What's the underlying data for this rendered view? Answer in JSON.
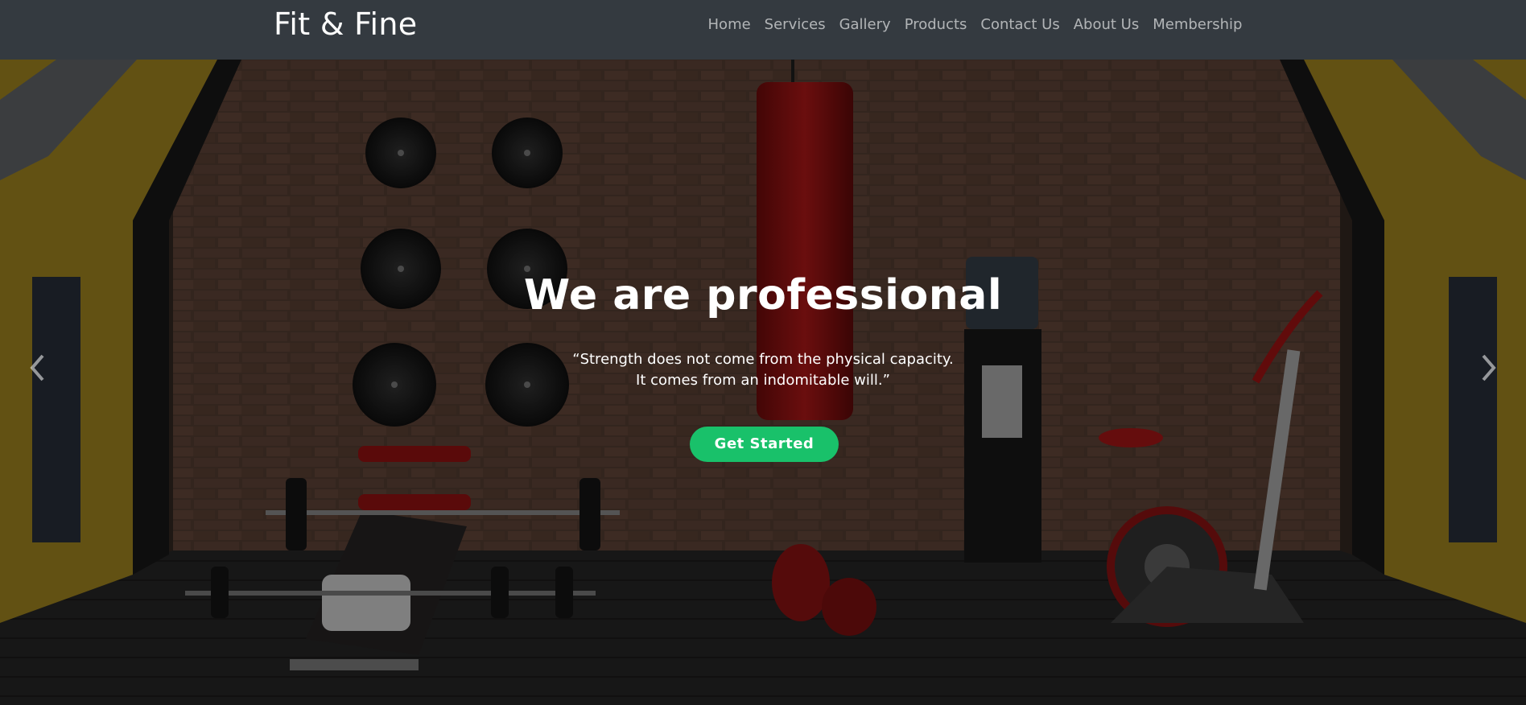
{
  "navbar": {
    "brand": "Fit & Fine",
    "links": [
      "Home",
      "Services",
      "Gallery",
      "Products",
      "Contact Us",
      "About Us",
      "Membership"
    ]
  },
  "hero": {
    "title": "We are professional",
    "quote_line1": "“Strength does not come from the physical capacity.",
    "quote_line2": "It comes from an indomitable will.”",
    "cta_label": "Get Started",
    "prev_icon": "chevron-left-icon",
    "next_icon": "chevron-right-icon"
  },
  "colors": {
    "navbar_bg": "#343a40",
    "cta_bg": "#19c16a",
    "overlay": "rgba(0,0,0,0.45)"
  }
}
